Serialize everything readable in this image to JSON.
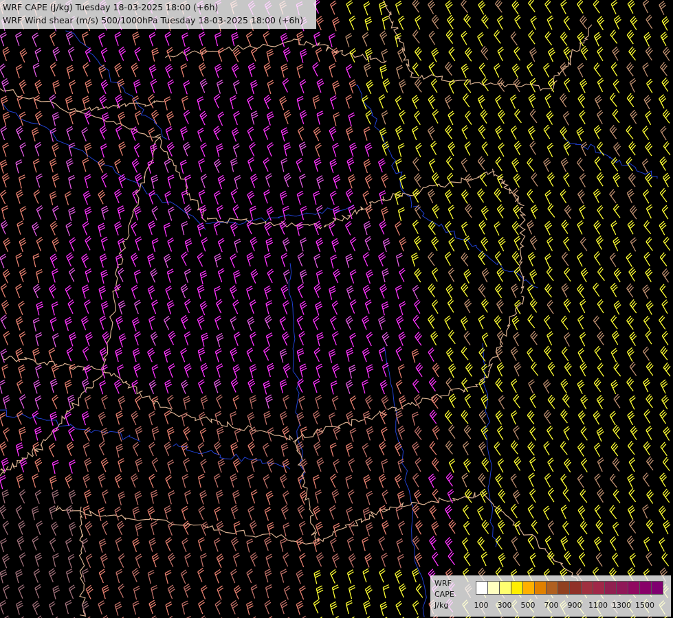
{
  "title": {
    "line1": "WRF CAPE (J/kg) Tuesday 18-03-2025 18:00 (+6h)",
    "line2": "WRF Wind shear (m/s) 500/1000hPa Tuesday 18-03-2025 18:00 (+6h)"
  },
  "legend": {
    "line1": "WRF",
    "line2": "CAPE",
    "line3": "J/kg",
    "ticks": [
      "100",
      "300",
      "500",
      "700",
      "900",
      "1100",
      "1300",
      "1500"
    ],
    "colors": [
      "#ffffff",
      "#ffffc0",
      "#ffff70",
      "#ffee00",
      "#ffb000",
      "#e08000",
      "#b06020",
      "#904020",
      "#903028",
      "#a03040",
      "#a02848",
      "#902050",
      "#901858",
      "#900a60",
      "#880068",
      "#800070"
    ]
  },
  "map_colors": {
    "background": "#000000",
    "borders": "#d8b090",
    "rivers": "#2040d0",
    "barb_colors": [
      "#ff33ff",
      "#e45be4",
      "#e88070",
      "#c07068",
      "#ffff33",
      "#c09070",
      "#a0707a"
    ]
  }
}
